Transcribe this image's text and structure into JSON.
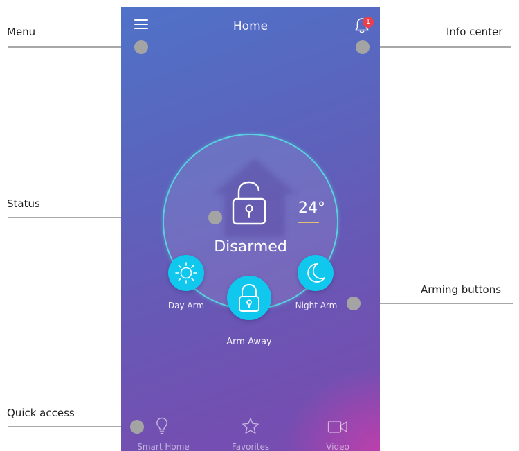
{
  "callouts": {
    "menu": "Menu",
    "info_center": "Info center",
    "status": "Status",
    "arming_buttons": "Arming buttons",
    "quick_access": "Quick access"
  },
  "header": {
    "title": "Home",
    "notification_count": "1"
  },
  "status": {
    "state": "Disarmed",
    "temperature": "24°"
  },
  "arming": {
    "day_arm": "Day Arm",
    "arm_away": "Arm Away",
    "night_arm": "Night Arm"
  },
  "quick_access": {
    "items": [
      {
        "label": "Smart Home",
        "icon": "lightbulb-icon"
      },
      {
        "label": "Favorites",
        "icon": "star-icon"
      },
      {
        "label": "Video",
        "icon": "video-camera-icon"
      }
    ]
  },
  "colors": {
    "accent": "#10c8ee",
    "ring": "#58d2df",
    "badge": "#e8404a",
    "temp_underline": "#e3c070",
    "background_top": "#4f72c8",
    "background_bottom": "#7a4ab0"
  }
}
